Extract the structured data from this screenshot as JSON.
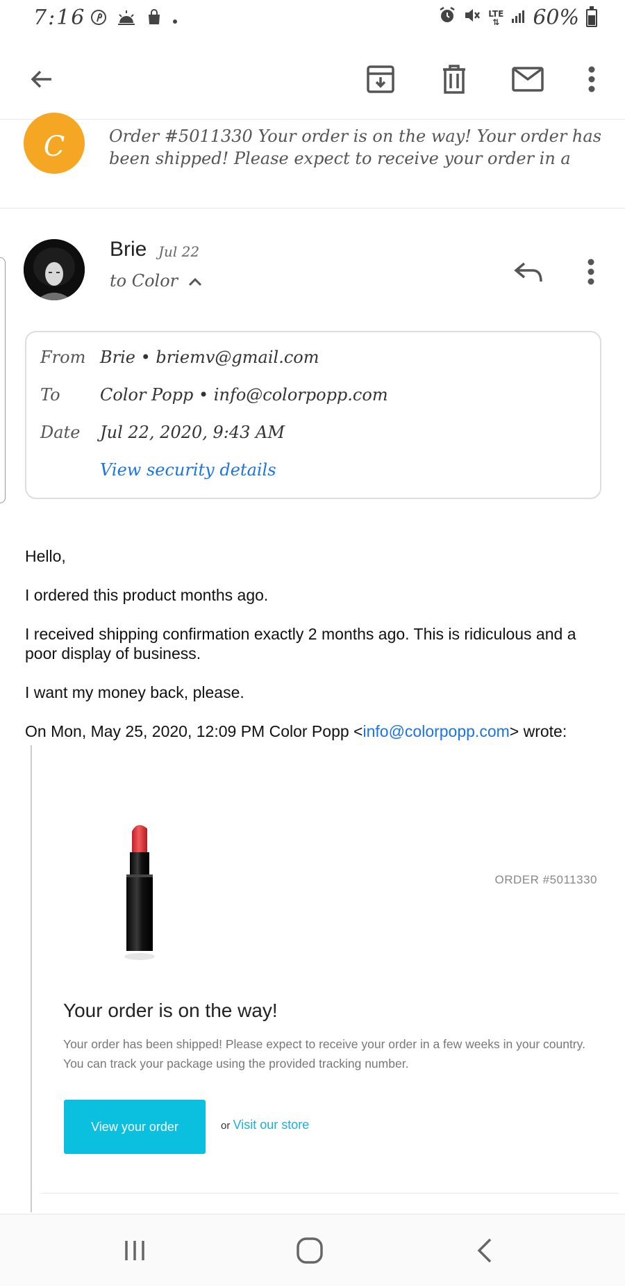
{
  "status_bar": {
    "time": "7:16",
    "battery": "60%",
    "network": "LTE"
  },
  "toolbar": {
    "icons": [
      "back-arrow-icon",
      "archive-icon",
      "delete-icon",
      "mark-unread-icon",
      "more-vert-icon"
    ]
  },
  "previous_message": {
    "avatar_letter": "C",
    "snippet": "Order #5011330 Your order is on the way! Your order has been shipped! Please expect to receive your order in a",
    "avatar_color": "#f5a623"
  },
  "message": {
    "sender": "Brie",
    "date": "Jul 22",
    "to_line": "to Color"
  },
  "details": {
    "from_label": "From",
    "from_value": "Brie • briemv@gmail.com",
    "to_label": "To",
    "to_value": "Color Popp • info@colorpopp.com",
    "date_label": "Date",
    "date_value": "Jul 22, 2020, 9:43 AM",
    "security_link": "View security details"
  },
  "body": {
    "greeting": "Hello,",
    "line1": "I ordered this product months ago.",
    "line2": "I received shipping confirmation exactly 2 months ago. This is ridiculous and a poor display of business.",
    "line3": "I want my money back, please.",
    "quote_intro_prefix": "On Mon, May 25, 2020, 12:09 PM Color Popp <",
    "quote_email": "info@colorpopp.com",
    "quote_intro_suffix": "> wrote:"
  },
  "quoted_email": {
    "order_number": "ORDER #5011330",
    "title": "Your order is on the way!",
    "description": "Your order has been shipped! Please expect to receive your order in a few weeks in your country. You can track your package using the provided tracking number.",
    "view_order_button": "View your order",
    "or_text": "or",
    "visit_store_link": "Visit our store",
    "button_color": "#0bbfdf"
  },
  "nav_bar": {
    "icons": [
      "recent-apps-icon",
      "home-icon",
      "back-icon"
    ]
  }
}
